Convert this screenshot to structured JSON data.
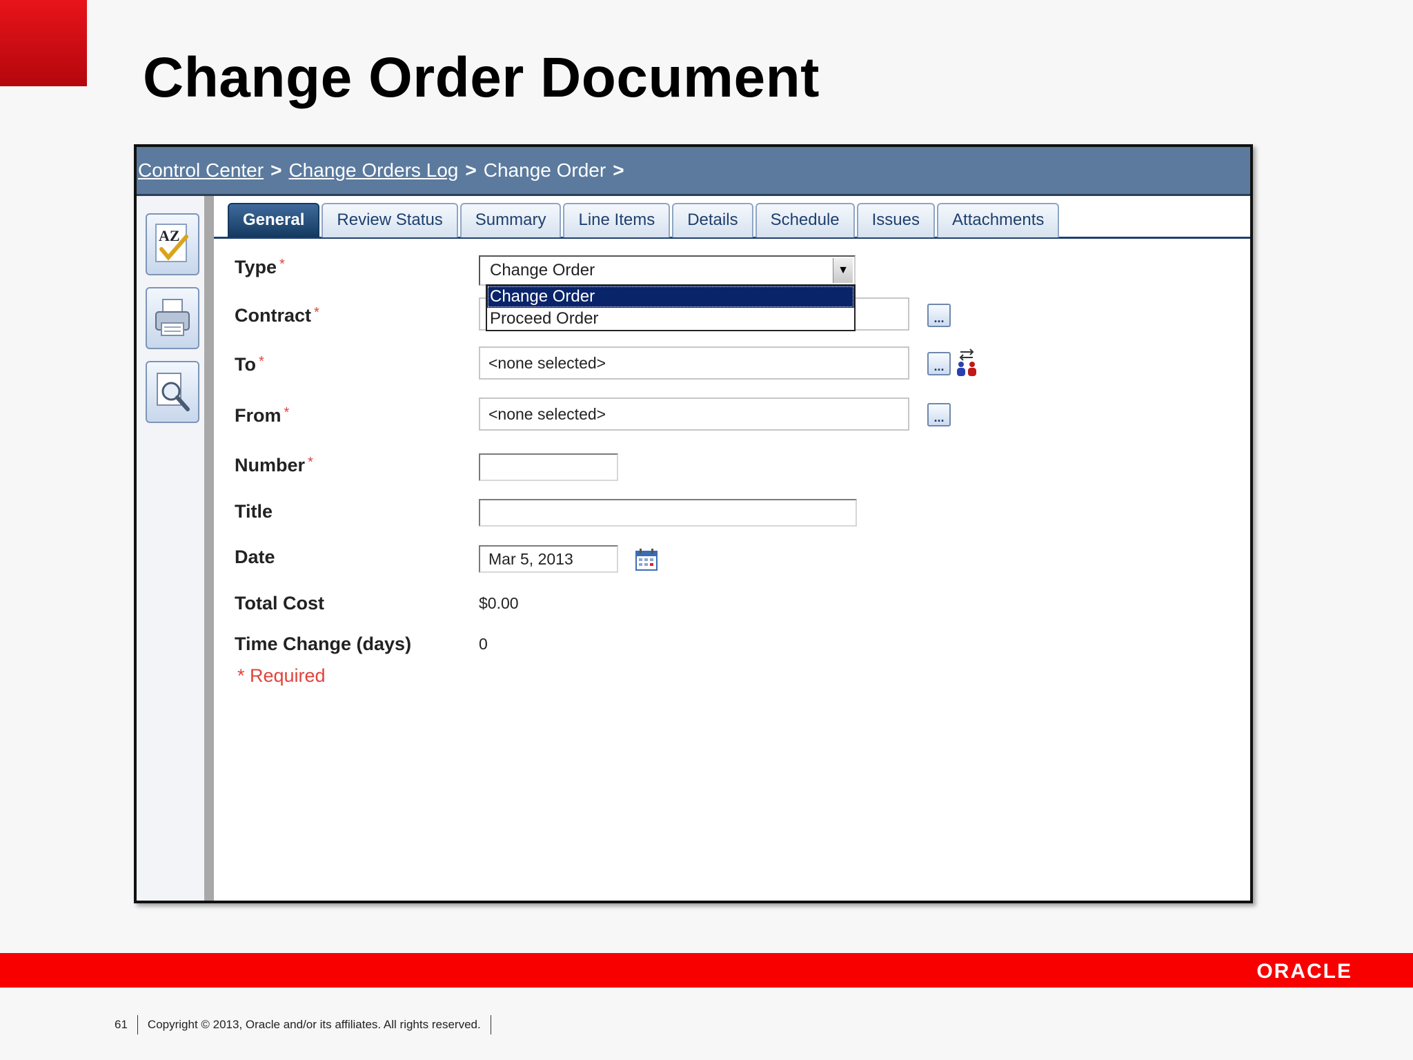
{
  "slide": {
    "title": "Change Order Document",
    "page_number": "61",
    "copyright": "Copyright © 2013, Oracle and/or its affiliates. All rights reserved.",
    "logo": "ORACLE",
    "accent_color": "#f80000"
  },
  "breadcrumb": {
    "items": [
      {
        "label": "Control Center",
        "link": true
      },
      {
        "label": "Change Orders Log",
        "link": true
      },
      {
        "label": "Change Order",
        "link": false
      }
    ],
    "separator": ">"
  },
  "sidebar": {
    "buttons": [
      {
        "name": "spellcheck-icon",
        "tooltip": "AZ"
      },
      {
        "name": "print-icon"
      },
      {
        "name": "print-preview-icon"
      }
    ]
  },
  "tabs": [
    {
      "label": "General",
      "active": true
    },
    {
      "label": "Review Status"
    },
    {
      "label": "Summary"
    },
    {
      "label": "Line Items"
    },
    {
      "label": "Details"
    },
    {
      "label": "Schedule"
    },
    {
      "label": "Issues"
    },
    {
      "label": "Attachments"
    }
  ],
  "form": {
    "type": {
      "label": "Type",
      "required": "*",
      "value": "Change Order",
      "options": [
        "Change Order",
        "Proceed Order"
      ],
      "selected_index": 0
    },
    "contract": {
      "label": "Contract",
      "required": "*",
      "value": ""
    },
    "to": {
      "label": "To",
      "required": "*",
      "value": "<none selected>"
    },
    "from": {
      "label": "From",
      "required": "*",
      "value": "<none selected>"
    },
    "number": {
      "label": "Number",
      "required": "*",
      "value": ""
    },
    "title": {
      "label": "Title",
      "value": ""
    },
    "date": {
      "label": "Date",
      "value": "Mar 5, 2013"
    },
    "total_cost": {
      "label": "Total Cost",
      "value": "$0.00"
    },
    "time_change": {
      "label": "Time Change (days)",
      "value": "0"
    },
    "required_note": "* Required",
    "lookup_button": "..."
  }
}
